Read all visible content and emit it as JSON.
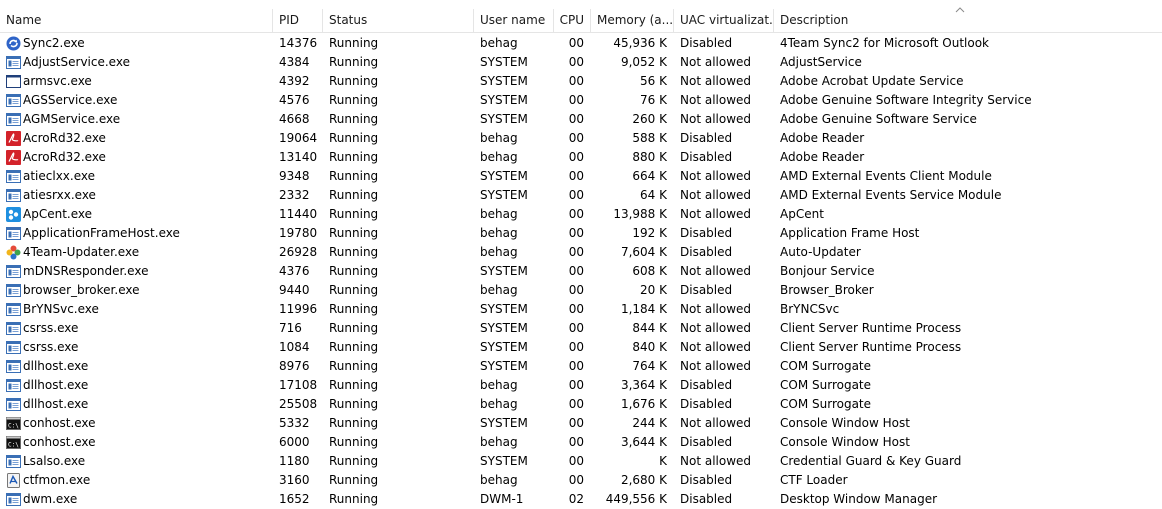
{
  "columns": {
    "name": "Name",
    "pid": "PID",
    "status": "Status",
    "user": "User name",
    "cpu": "CPU",
    "memory": "Memory (a...",
    "uac": "UAC virtualizat...",
    "description": "Description"
  },
  "rows": [
    {
      "icon": "sync-icon",
      "name": "Sync2.exe",
      "pid": "14376",
      "status": "Running",
      "user": "behag",
      "cpu": "00",
      "memory": "45,936 K",
      "uac": "Disabled",
      "description": "4Team Sync2 for Microsoft Outlook"
    },
    {
      "icon": "app-window-icon",
      "name": "AdjustService.exe",
      "pid": "4384",
      "status": "Running",
      "user": "SYSTEM",
      "cpu": "00",
      "memory": "9,052 K",
      "uac": "Not allowed",
      "description": "AdjustService"
    },
    {
      "icon": "blank-window-icon",
      "name": "armsvc.exe",
      "pid": "4392",
      "status": "Running",
      "user": "SYSTEM",
      "cpu": "00",
      "memory": "56 K",
      "uac": "Not allowed",
      "description": "Adobe Acrobat Update Service"
    },
    {
      "icon": "app-window-icon",
      "name": "AGSService.exe",
      "pid": "4576",
      "status": "Running",
      "user": "SYSTEM",
      "cpu": "00",
      "memory": "76 K",
      "uac": "Not allowed",
      "description": "Adobe Genuine Software Integrity Service"
    },
    {
      "icon": "app-window-icon",
      "name": "AGMService.exe",
      "pid": "4668",
      "status": "Running",
      "user": "SYSTEM",
      "cpu": "00",
      "memory": "260 K",
      "uac": "Not allowed",
      "description": "Adobe Genuine Software Service"
    },
    {
      "icon": "acrobat-icon",
      "name": "AcroRd32.exe",
      "pid": "19064",
      "status": "Running",
      "user": "behag",
      "cpu": "00",
      "memory": "588 K",
      "uac": "Disabled",
      "description": "Adobe Reader"
    },
    {
      "icon": "acrobat-icon",
      "name": "AcroRd32.exe",
      "pid": "13140",
      "status": "Running",
      "user": "behag",
      "cpu": "00",
      "memory": "880 K",
      "uac": "Disabled",
      "description": "Adobe Reader"
    },
    {
      "icon": "app-window-icon",
      "name": "atieclxx.exe",
      "pid": "9348",
      "status": "Running",
      "user": "SYSTEM",
      "cpu": "00",
      "memory": "664 K",
      "uac": "Not allowed",
      "description": "AMD External Events Client Module"
    },
    {
      "icon": "app-window-icon",
      "name": "atiesrxx.exe",
      "pid": "2332",
      "status": "Running",
      "user": "SYSTEM",
      "cpu": "00",
      "memory": "64 K",
      "uac": "Not allowed",
      "description": "AMD External Events Service Module"
    },
    {
      "icon": "apcent-icon",
      "name": "ApCent.exe",
      "pid": "11440",
      "status": "Running",
      "user": "behag",
      "cpu": "00",
      "memory": "13,988 K",
      "uac": "Not allowed",
      "description": "ApCent"
    },
    {
      "icon": "app-window-icon",
      "name": "ApplicationFrameHost.exe",
      "pid": "19780",
      "status": "Running",
      "user": "behag",
      "cpu": "00",
      "memory": "192 K",
      "uac": "Disabled",
      "description": "Application Frame Host"
    },
    {
      "icon": "updater-icon",
      "name": "4Team-Updater.exe",
      "pid": "26928",
      "status": "Running",
      "user": "behag",
      "cpu": "00",
      "memory": "7,604 K",
      "uac": "Disabled",
      "description": "Auto-Updater"
    },
    {
      "icon": "app-window-icon",
      "name": "mDNSResponder.exe",
      "pid": "4376",
      "status": "Running",
      "user": "SYSTEM",
      "cpu": "00",
      "memory": "608 K",
      "uac": "Not allowed",
      "description": "Bonjour Service"
    },
    {
      "icon": "app-window-icon",
      "name": "browser_broker.exe",
      "pid": "9440",
      "status": "Running",
      "user": "behag",
      "cpu": "00",
      "memory": "20 K",
      "uac": "Disabled",
      "description": "Browser_Broker"
    },
    {
      "icon": "app-window-icon",
      "name": "BrYNSvc.exe",
      "pid": "11996",
      "status": "Running",
      "user": "SYSTEM",
      "cpu": "00",
      "memory": "1,184 K",
      "uac": "Not allowed",
      "description": "BrYNCSvc"
    },
    {
      "icon": "app-window-icon",
      "name": "csrss.exe",
      "pid": "716",
      "status": "Running",
      "user": "SYSTEM",
      "cpu": "00",
      "memory": "844 K",
      "uac": "Not allowed",
      "description": "Client Server Runtime Process"
    },
    {
      "icon": "app-window-icon",
      "name": "csrss.exe",
      "pid": "1084",
      "status": "Running",
      "user": "SYSTEM",
      "cpu": "00",
      "memory": "840 K",
      "uac": "Not allowed",
      "description": "Client Server Runtime Process"
    },
    {
      "icon": "app-window-icon",
      "name": "dllhost.exe",
      "pid": "8976",
      "status": "Running",
      "user": "SYSTEM",
      "cpu": "00",
      "memory": "764 K",
      "uac": "Not allowed",
      "description": "COM Surrogate"
    },
    {
      "icon": "app-window-icon",
      "name": "dllhost.exe",
      "pid": "17108",
      "status": "Running",
      "user": "behag",
      "cpu": "00",
      "memory": "3,364 K",
      "uac": "Disabled",
      "description": "COM Surrogate"
    },
    {
      "icon": "app-window-icon",
      "name": "dllhost.exe",
      "pid": "25508",
      "status": "Running",
      "user": "behag",
      "cpu": "00",
      "memory": "1,676 K",
      "uac": "Disabled",
      "description": "COM Surrogate"
    },
    {
      "icon": "console-icon",
      "name": "conhost.exe",
      "pid": "5332",
      "status": "Running",
      "user": "SYSTEM",
      "cpu": "00",
      "memory": "244 K",
      "uac": "Not allowed",
      "description": "Console Window Host"
    },
    {
      "icon": "console-icon",
      "name": "conhost.exe",
      "pid": "6000",
      "status": "Running",
      "user": "behag",
      "cpu": "00",
      "memory": "3,644 K",
      "uac": "Disabled",
      "description": "Console Window Host"
    },
    {
      "icon": "app-window-icon",
      "name": "Lsalso.exe",
      "pid": "1180",
      "status": "Running",
      "user": "SYSTEM",
      "cpu": "00",
      "memory": "K",
      "uac": "Not allowed",
      "description": "Credential Guard & Key Guard"
    },
    {
      "icon": "ctf-icon",
      "name": "ctfmon.exe",
      "pid": "3160",
      "status": "Running",
      "user": "behag",
      "cpu": "00",
      "memory": "2,680 K",
      "uac": "Disabled",
      "description": "CTF Loader"
    },
    {
      "icon": "app-window-icon",
      "name": "dwm.exe",
      "pid": "1652",
      "status": "Running",
      "user": "DWM-1",
      "cpu": "02",
      "memory": "449,556 K",
      "uac": "Disabled",
      "description": "Desktop Window Manager"
    }
  ]
}
